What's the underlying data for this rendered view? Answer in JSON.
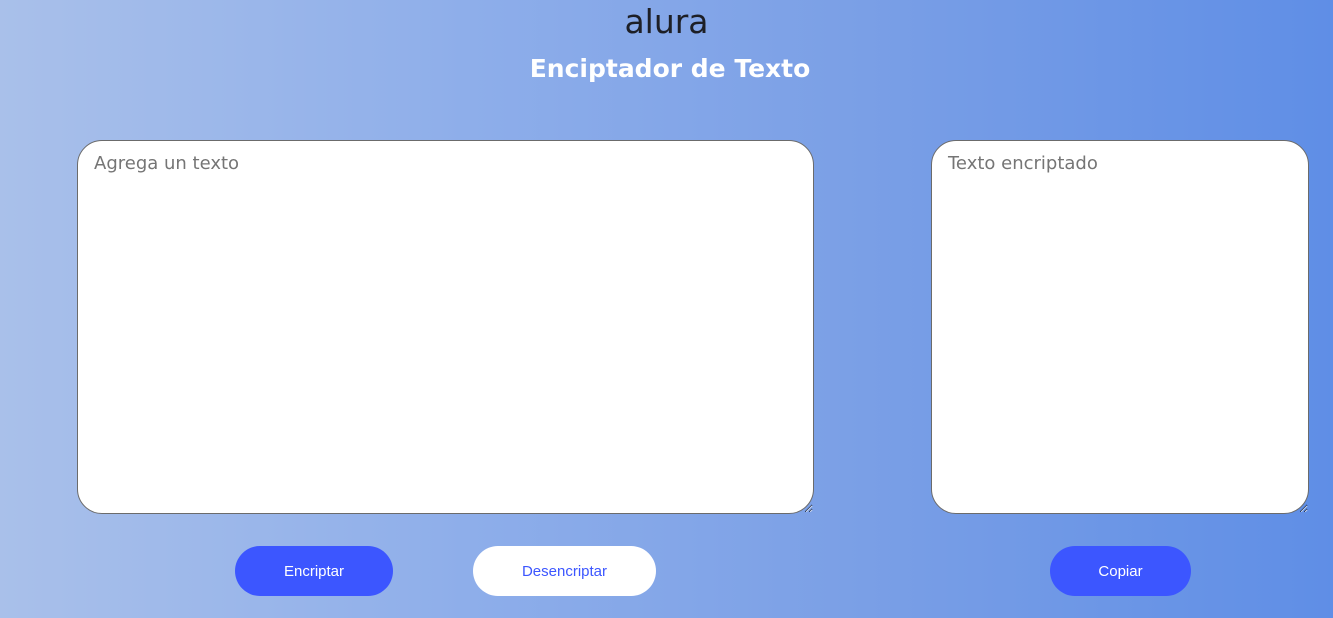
{
  "header": {
    "logo_text": "alura",
    "title": "Enciptador de Texto"
  },
  "input": {
    "placeholder": "Agrega un texto",
    "value": ""
  },
  "output": {
    "placeholder": "Texto encriptado",
    "value": ""
  },
  "buttons": {
    "encrypt_label": "Encriptar",
    "decrypt_label": "Desencriptar",
    "copy_label": "Copiar"
  },
  "colors": {
    "accent": "#3c56ff",
    "background_start": "#a9c0ea",
    "background_end": "#5f8ee6",
    "title_text": "#ffffff"
  }
}
